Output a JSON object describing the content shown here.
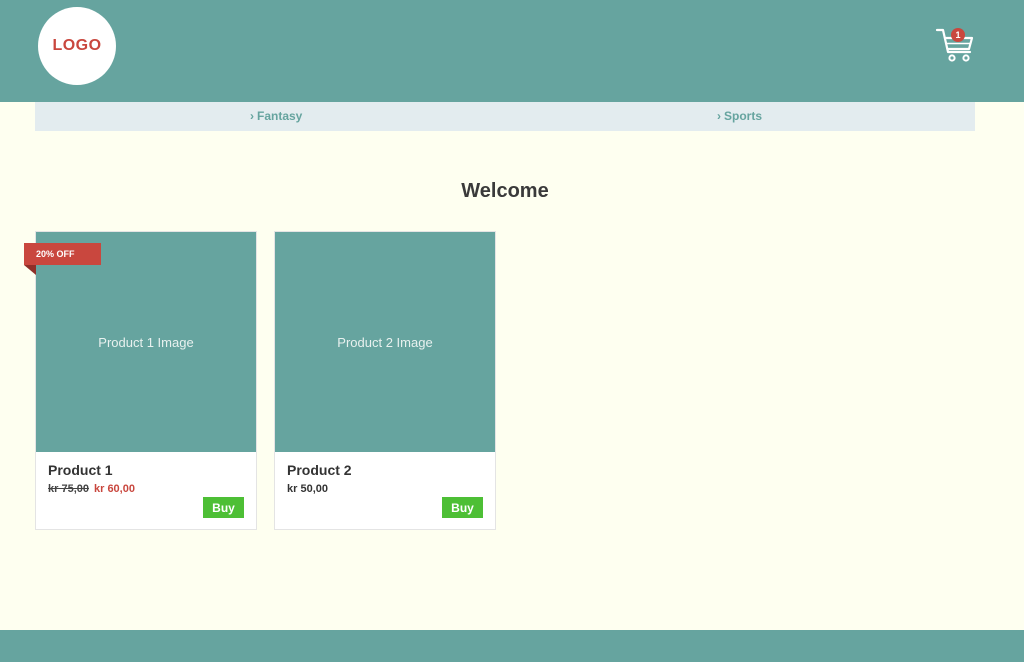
{
  "header": {
    "logo_text": "LOGO",
    "cart": {
      "icon": "cart-icon",
      "badge_count": "1"
    }
  },
  "nav": {
    "items": [
      {
        "label": "Fantasy",
        "icon": "chevron-right-icon"
      },
      {
        "label": "Sports",
        "icon": "chevron-right-icon"
      }
    ]
  },
  "main": {
    "title": "Welcome",
    "products": [
      {
        "image_placeholder": "Product 1 Image",
        "name": "Product 1",
        "old_price": "kr 75,00",
        "price": "kr 60,00",
        "badge": "20% OFF",
        "buy_label": "Buy"
      },
      {
        "image_placeholder": "Product 2 Image",
        "name": "Product 2",
        "price": "kr 50,00",
        "buy_label": "Buy"
      }
    ]
  },
  "colors": {
    "primary": "#66a49f",
    "accent": "#c9473e",
    "buy_button": "#4dbf35",
    "background": "#fefff0",
    "nav_background": "#e3ecef"
  }
}
